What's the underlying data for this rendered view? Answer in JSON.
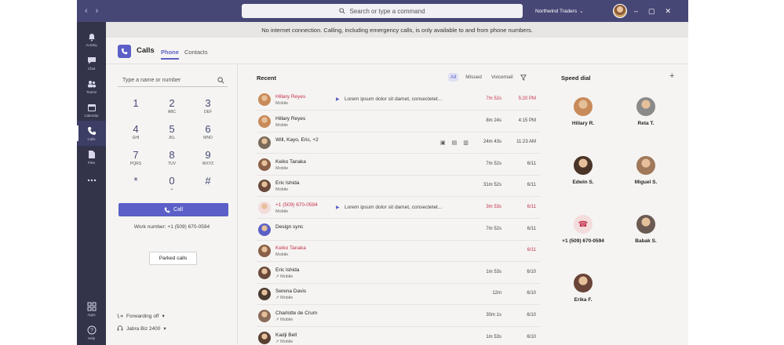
{
  "titlebar": {
    "search_placeholder": "Search or type a command",
    "tenant": "Northwind Traders",
    "tenant_caret": "⌄"
  },
  "rail": [
    {
      "label": "Activity",
      "icon": "bell-icon"
    },
    {
      "label": "Chat",
      "icon": "chat-icon"
    },
    {
      "label": "Teams",
      "icon": "teams-icon"
    },
    {
      "label": "Calendar",
      "icon": "calendar-icon"
    },
    {
      "label": "Calls",
      "icon": "phone-icon"
    },
    {
      "label": "Files",
      "icon": "files-icon"
    },
    {
      "label": "",
      "icon": "more-icon"
    },
    {
      "label": "Apps",
      "icon": "apps-icon"
    },
    {
      "label": "Help",
      "icon": "help-icon"
    }
  ],
  "banner": "No internet connection. Calling, including emergency calls, is only available to and from phone numbers.",
  "header": {
    "title": "Calls",
    "tabs": [
      "Phone",
      "Contacts"
    ]
  },
  "dialer": {
    "placeholder": "Type a name or number",
    "keys": [
      {
        "digit": "1",
        "letters": ""
      },
      {
        "digit": "2",
        "letters": "ABC"
      },
      {
        "digit": "3",
        "letters": "DEF"
      },
      {
        "digit": "4",
        "letters": "GHI"
      },
      {
        "digit": "5",
        "letters": "JKL"
      },
      {
        "digit": "6",
        "letters": "MNO"
      },
      {
        "digit": "7",
        "letters": "PQRS"
      },
      {
        "digit": "8",
        "letters": "TUV"
      },
      {
        "digit": "9",
        "letters": "WXYZ"
      },
      {
        "digit": "*",
        "letters": ""
      },
      {
        "digit": "0",
        "letters": "+"
      },
      {
        "digit": "#",
        "letters": ""
      }
    ],
    "call_label": "Call",
    "work_number": "Work number: +1 (509) 670-0594",
    "parked_label": "Parked calls",
    "forwarding": "Forwarding off",
    "device": "Jabra Biz 2400"
  },
  "recent": {
    "title": "Recent",
    "filters": [
      "All",
      "Missed",
      "Voicemail"
    ],
    "rows": [
      {
        "name": "Hillary Reyes",
        "sub": "Mobile",
        "msg": "Lorem ipsum dolor sit damet, consectetet...",
        "duration": "7m 52s",
        "time": "5:20 PM",
        "missed": true,
        "voicemail": true,
        "color": "#c98a5a"
      },
      {
        "name": "Hillary Reyes",
        "sub": "Mobile",
        "msg": "",
        "duration": "8m 24s",
        "time": "4:15 PM",
        "missed": false,
        "voicemail": false,
        "color": "#c98a5a"
      },
      {
        "name": "Will, Kayo, Eric, +2",
        "sub": "",
        "msg": "",
        "duration": "24m 43s",
        "time": "11:23 AM",
        "missed": false,
        "voicemail": false,
        "color": "#7a6a5a"
      },
      {
        "name": "Keiko Tanaka",
        "sub": "Mobile",
        "msg": "",
        "duration": "7m 52s",
        "time": "6/11",
        "missed": false,
        "voicemail": false,
        "color": "#8a6048"
      },
      {
        "name": "Eric Ishida",
        "sub": "Mobile",
        "msg": "",
        "duration": "31m 52s",
        "time": "6/11",
        "missed": false,
        "voicemail": false,
        "color": "#6a4a3a"
      },
      {
        "name": "+1 (509) 670-0594",
        "sub": "Mobile",
        "msg": "Lorem ipsum dolor sit damet, consectetet...",
        "duration": "3m 53s",
        "time": "6/11",
        "missed": true,
        "voicemail": true,
        "color": "#f3dcdc"
      },
      {
        "name": "Design sync",
        "sub": "",
        "msg": "",
        "duration": "7m 52s",
        "time": "6/11",
        "missed": false,
        "voicemail": false,
        "color": "#5b5fc7"
      },
      {
        "name": "Keiko Tanaka",
        "sub": "Mobile",
        "msg": "",
        "duration": "",
        "time": "6/11",
        "missed": true,
        "voicemail": false,
        "color": "#8a6048"
      },
      {
        "name": "Eric Ishida",
        "sub": "↗ Mobile",
        "msg": "",
        "duration": "1m 53s",
        "time": "6/10",
        "missed": false,
        "voicemail": false,
        "color": "#6a4a3a"
      },
      {
        "name": "Serena Davis",
        "sub": "↗ Mobile",
        "msg": "",
        "duration": "12m",
        "time": "6/10",
        "missed": false,
        "voicemail": false,
        "color": "#4a3a30"
      },
      {
        "name": "Charlotte de Crum",
        "sub": "↗ Mobile",
        "msg": "",
        "duration": "30m 1s",
        "time": "6/10",
        "missed": false,
        "voicemail": false,
        "color": "#8a6a58"
      },
      {
        "name": "Kadji Bell",
        "sub": "↗ Mobile",
        "msg": "",
        "duration": "1m 53s",
        "time": "6/10",
        "missed": false,
        "voicemail": false,
        "color": "#5a4032"
      }
    ]
  },
  "speed_dial": {
    "title": "Speed dial",
    "add": "+",
    "contacts": [
      {
        "name": "Hillary R.",
        "color": "#c98a5a"
      },
      {
        "name": "Reta T.",
        "color": "#8a8a8a"
      },
      {
        "name": "Edwin S.",
        "color": "#4a3428"
      },
      {
        "name": "Miguel S.",
        "color": "#a0785a"
      },
      {
        "name": "+1 (509) 670-0594",
        "color": "#f3dcdc"
      },
      {
        "name": "Babak S.",
        "color": "#6a5a52"
      },
      {
        "name": "Erika F.",
        "color": "#6a4438"
      }
    ]
  }
}
